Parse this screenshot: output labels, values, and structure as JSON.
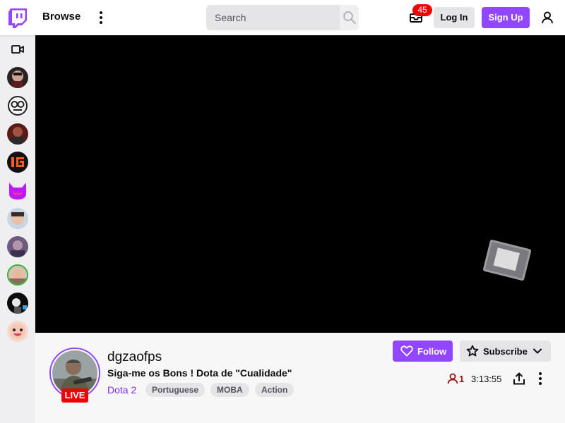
{
  "header": {
    "logo_icon": "twitch-glitch-logo-icon",
    "browse_label": "Browse",
    "more_icon": "more-vertical-icon",
    "search": {
      "placeholder": "Search",
      "value": "",
      "button_icon": "search-icon"
    },
    "inbox": {
      "icon": "inbox-icon",
      "badge_count": "45"
    },
    "login_label": "Log In",
    "signup_label": "Sign Up",
    "user_icon": "user-icon"
  },
  "sidebar": {
    "header_icon": "video-camera-icon",
    "channels": [
      {
        "icon": "channel-avatar-icon"
      },
      {
        "icon": "channel-avatar-icon"
      },
      {
        "icon": "channel-avatar-icon"
      },
      {
        "icon": "channel-avatar-icon"
      },
      {
        "icon": "channel-avatar-icon"
      },
      {
        "icon": "channel-avatar-icon"
      },
      {
        "icon": "channel-avatar-icon"
      },
      {
        "icon": "channel-avatar-icon"
      },
      {
        "icon": "channel-avatar-icon"
      },
      {
        "icon": "channel-avatar-icon"
      }
    ]
  },
  "stream": {
    "live_label": "LIVE",
    "channel_name": "dgzaofps",
    "title": "Siga-me os Bons ! Dota de \"Cualidade\"",
    "game": "Dota 2",
    "tags": [
      "Portuguese",
      "MOBA",
      "Action"
    ],
    "follow_label": "Follow",
    "subscribe_label": "Subscribe",
    "viewer_count": "1",
    "uptime": "3:13:55"
  },
  "colors": {
    "brand": "#9147ff",
    "live_red": "#eb0400",
    "viewer_red": "#971311",
    "game_link": "#772ce8"
  }
}
